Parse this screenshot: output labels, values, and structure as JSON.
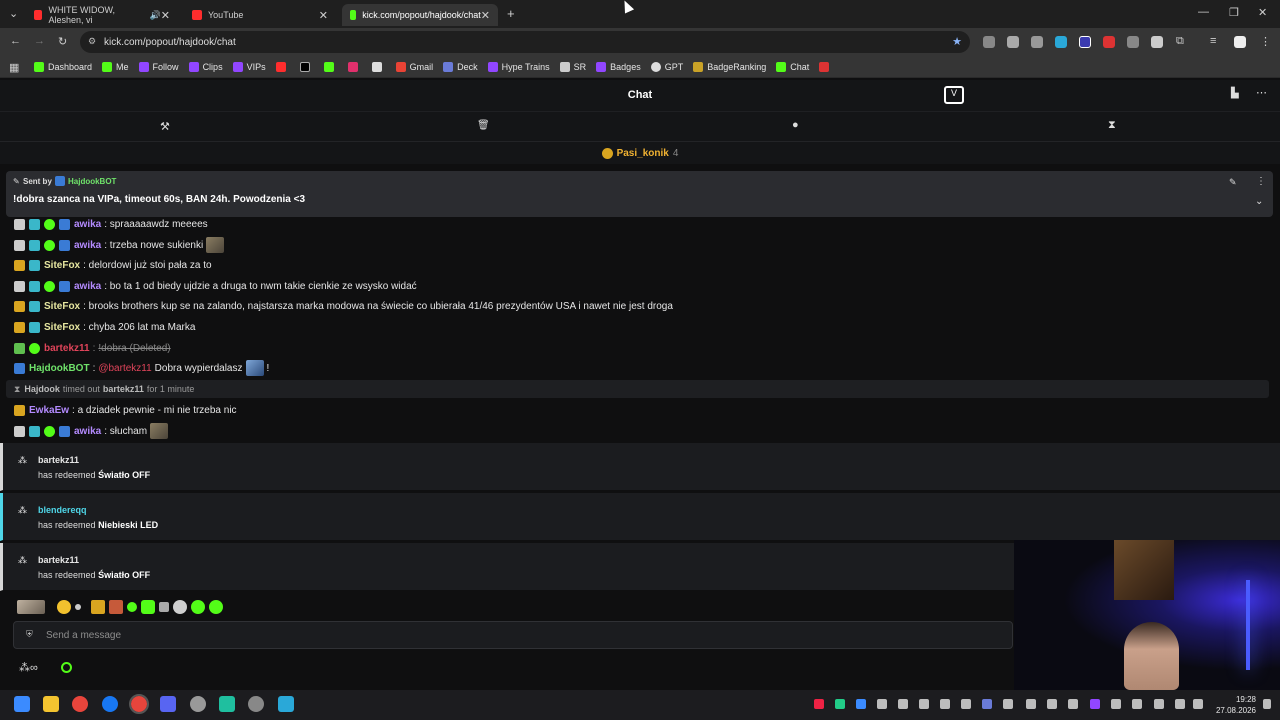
{
  "browser": {
    "tabs": [
      {
        "label": "WHITE WIDOW, Aleshen, vi",
        "active": false
      },
      {
        "label": "YouTube",
        "active": false
      },
      {
        "label": "kick.com/popout/hajdook/chat",
        "active": true
      }
    ],
    "url": "kick.com/popout/hajdook/chat",
    "bookmarks": [
      "Dashboard",
      "Me",
      "Follow",
      "Clips",
      "VIPs",
      "Gmail",
      "Deck",
      "Hype Trains",
      "SR",
      "Badges",
      "GPT",
      "BadgeRanking",
      "Chat"
    ]
  },
  "chat": {
    "title": "Chat",
    "top_user": {
      "name": "Pasi_konik",
      "count": "4"
    },
    "pinned": {
      "sent_by_label": "Sent by",
      "sender": "HajdookBOT",
      "text": "!dobra szanca na VIPa, timeout 60s, BAN 24h. Powodzenia <3"
    },
    "messages": [
      {
        "user": "awika",
        "text": ": spraaaaawdz meeees",
        "color": "#b48bff"
      },
      {
        "user": "awika",
        "text": ": trzeba nowe sukienki",
        "color": "#b48bff"
      },
      {
        "user": "SiteFox",
        "text": ": delordowi już stoi pała za to",
        "color": "#e6e6a0"
      },
      {
        "user": "awika",
        "text": ": bo ta 1 od biedy ujdzie a druga to nwm takie cienkie ze wsysko widać",
        "color": "#b48bff"
      },
      {
        "user": "SiteFox",
        "text": ": brooks brothers kup se na zalando, najstarsza marka modowa na świecie co ubierała 41/46 prezydentów USA i nawet nie jest droga",
        "color": "#e6e6a0"
      },
      {
        "user": "SiteFox",
        "text": ": chyba 206 lat ma Marka",
        "color": "#e6e6a0"
      },
      {
        "user": "bartekz11",
        "text": "!dobra (Deleted)",
        "color": "#e0445a"
      },
      {
        "user": "HajdookBOT",
        "mention": "@bartekz11",
        "text": "Dobra wypierdalasz",
        "suffix": "!",
        "color": "#6fe26a"
      },
      {
        "user": "EwkaEw",
        "text": ": a dziadek pewnie - mi nie trzeba nic",
        "color": "#b48bff"
      },
      {
        "user": "awika",
        "text": ": słucham",
        "color": "#b48bff"
      }
    ],
    "timeout_notice": {
      "mod": "Hajdook",
      "middle": "timed out",
      "target": "bartekz11",
      "duration": "for 1 minute"
    },
    "redeems": [
      {
        "user": "bartekz11",
        "prefix": "has redeemed",
        "reward": "Światło OFF",
        "color": "#e6e6e6"
      },
      {
        "user": "blendereqq",
        "prefix": "has redeemed",
        "reward": "Niebieski LED",
        "color": "#4fd6e8"
      },
      {
        "user": "bartekz11",
        "prefix": "has redeemed",
        "reward": "Światło OFF",
        "color": "#e6e6e6"
      }
    ],
    "input_placeholder": "Send a message"
  },
  "taskbar": {
    "time": "19:28",
    "date": "27.08.2026"
  },
  "colors": {
    "kick_green": "#53fc18",
    "bg": "#0f0f10",
    "panel": "#141517"
  }
}
